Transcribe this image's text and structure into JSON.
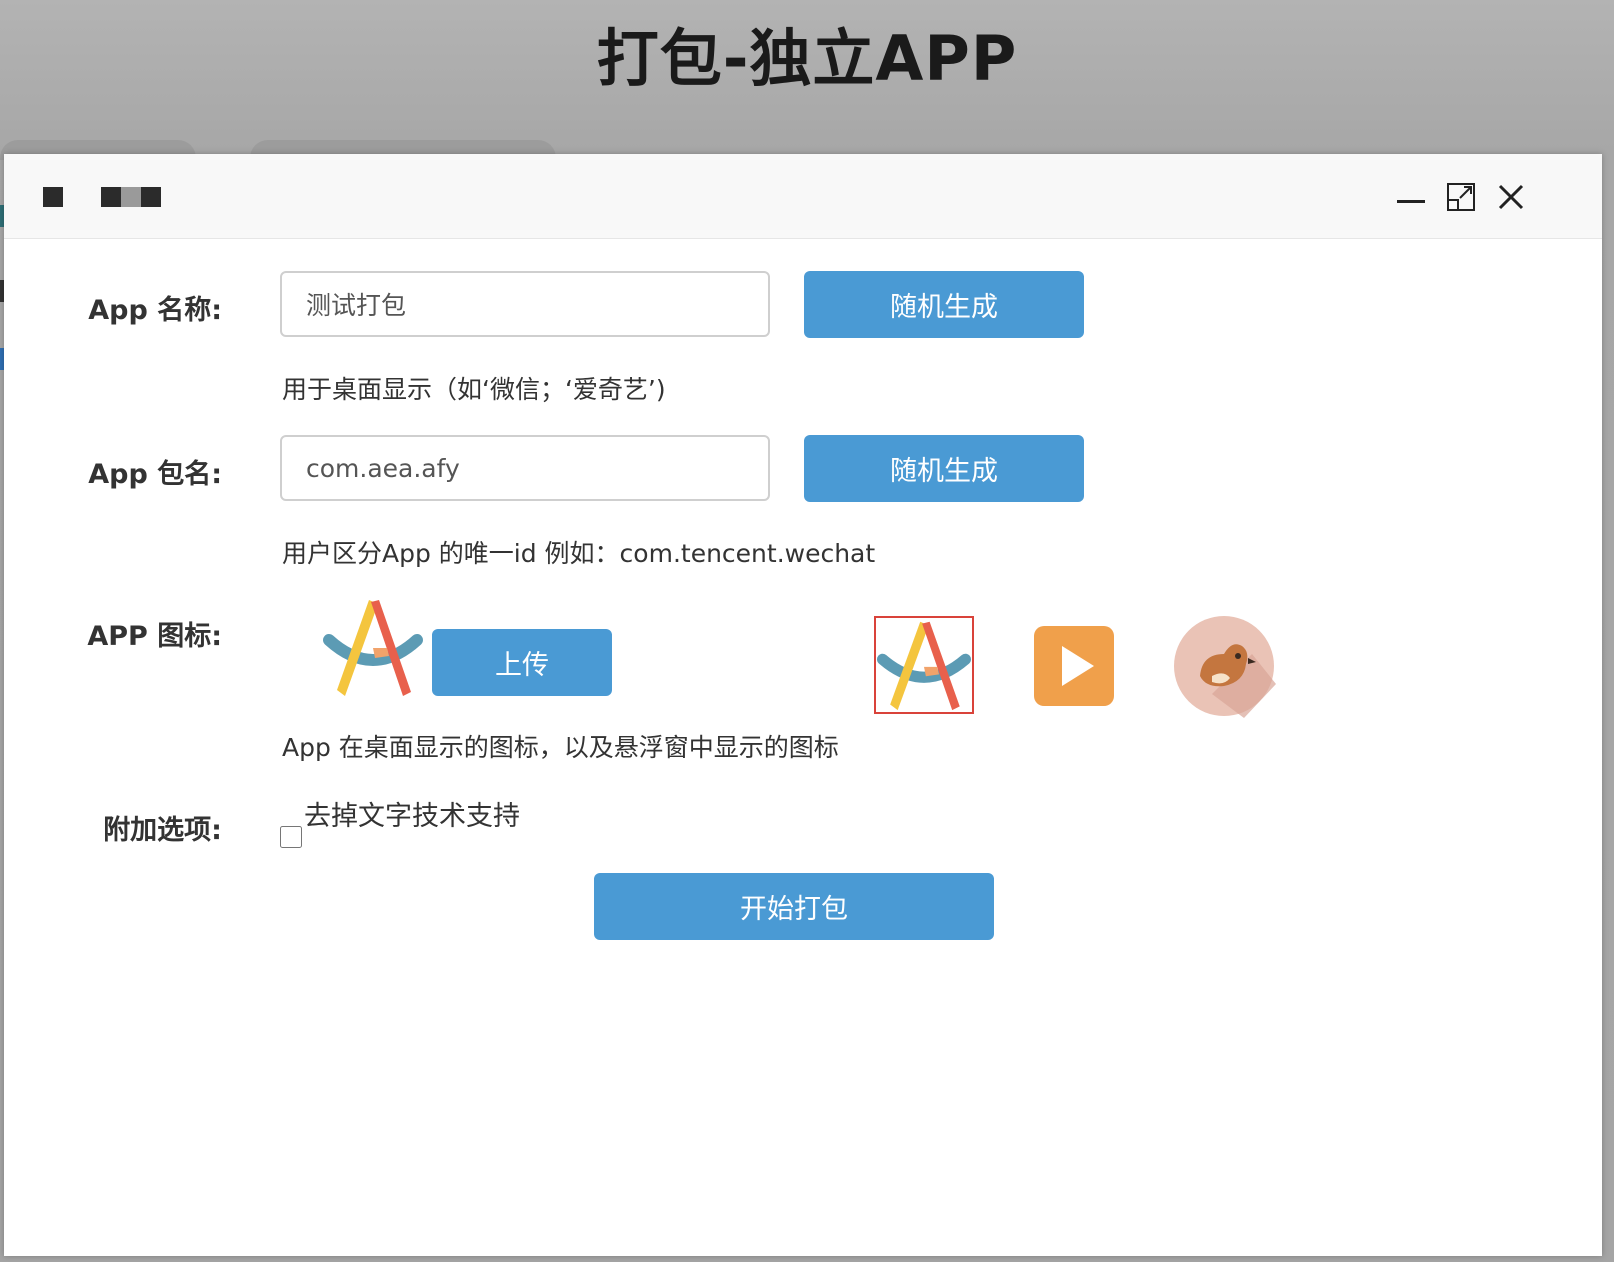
{
  "page_title": "打包-独立APP",
  "dialog": {
    "title_icon": "redacted-title-icon",
    "controls": {
      "minimize": "minimize-icon",
      "maximize": "maximize-icon",
      "close": "close-icon"
    }
  },
  "form": {
    "app_name": {
      "label": "App 名称:",
      "value": "测试打包",
      "button": "随机生成",
      "hint": "用于桌面显示（如‘微信；‘爱奇艺’)"
    },
    "package_name": {
      "label": "App 包名:",
      "value": "com.aea.afy",
      "button": "随机生成",
      "hint": "用户区分App 的唯一id 例如：com.tencent.wechat"
    },
    "app_icon": {
      "label": "APP 图标:",
      "upload_button": "上传",
      "hint": "App 在桌面显示的图标，以及悬浮窗中显示的图标",
      "current_icon": "letter-a-logo-icon",
      "choices": [
        "letter-a-logo-icon",
        "play-icon",
        "bird-icon"
      ],
      "selected_index": 0,
      "colors": {
        "selected_border": "#d9433a",
        "play_bg": "#f0a04b",
        "bird_bg": "#eac3b6"
      }
    },
    "options": {
      "label": "附加选项:",
      "checkbox_label": "去掉文字技术支持",
      "checked": false
    },
    "submit_button": "开始打包"
  },
  "colors": {
    "primary": "#4a9ad4",
    "text": "#333333",
    "input_border": "#cfcfcf"
  }
}
